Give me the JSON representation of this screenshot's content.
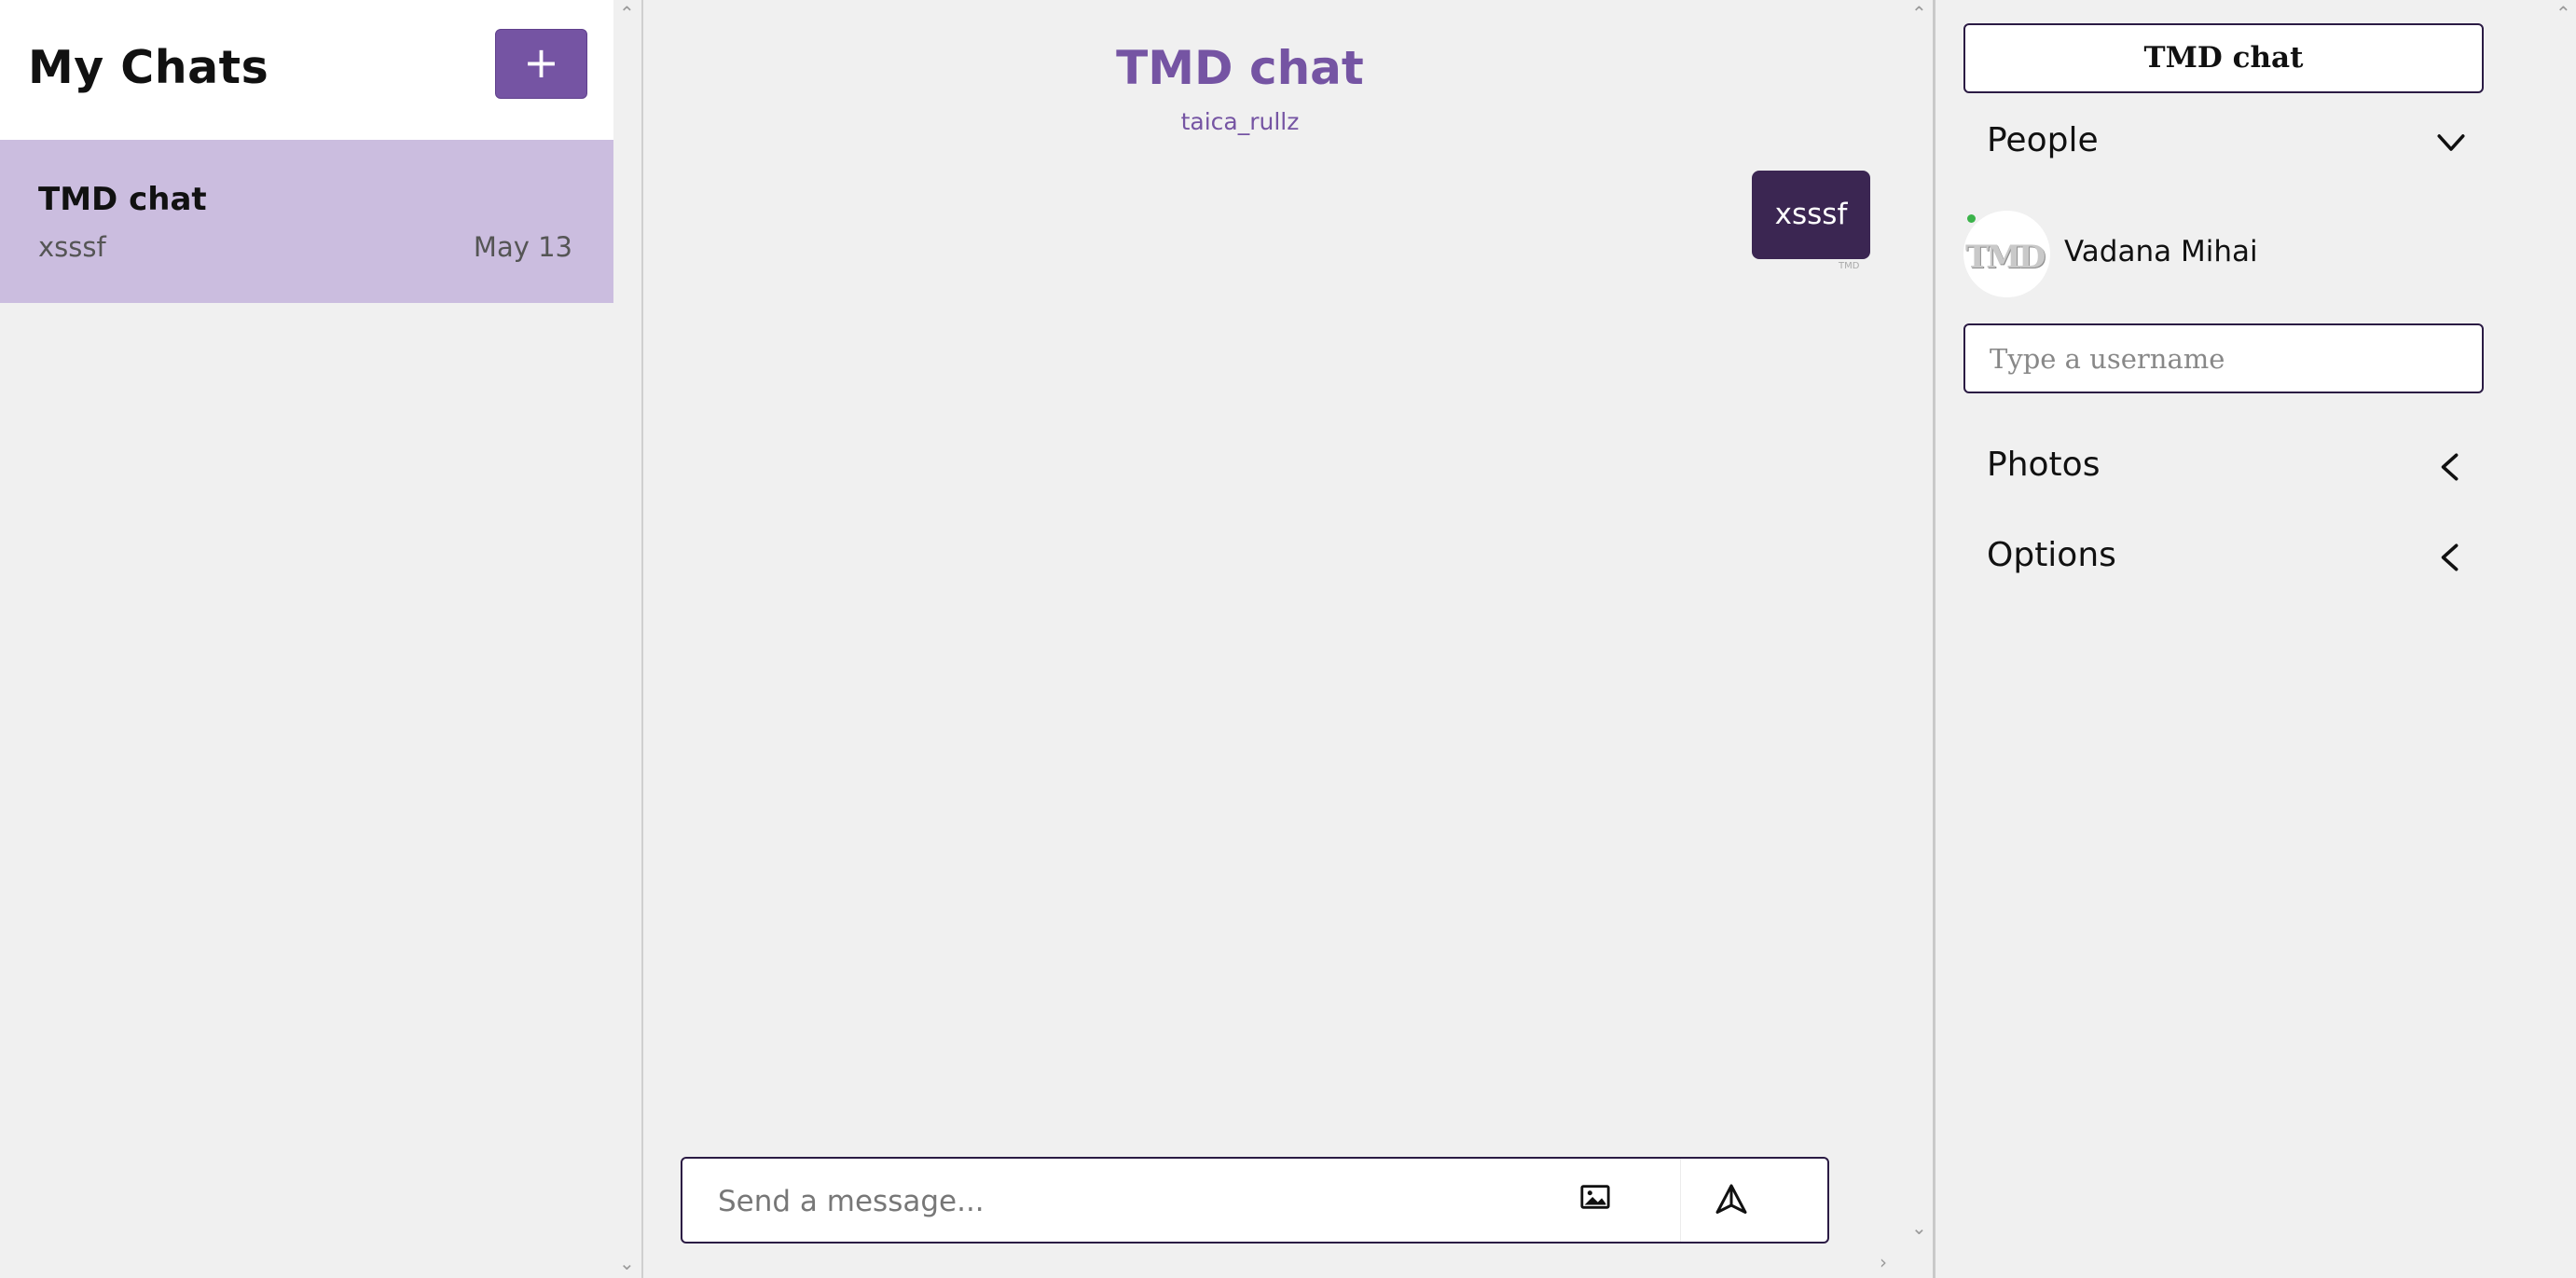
{
  "sidebar": {
    "title": "My Chats",
    "new_chat_label": "+",
    "chats": [
      {
        "title": "TMD chat",
        "last_message": "xsssf",
        "date": "May 13"
      }
    ]
  },
  "chat": {
    "title": "TMD chat",
    "subtitle": "taica_rullz",
    "messages": [
      {
        "text": "xsssf",
        "meta": "TMD"
      }
    ],
    "composer": {
      "placeholder": "Send a message...",
      "image_icon": "image-icon",
      "send_icon": "send-icon"
    }
  },
  "details": {
    "title": "TMD chat",
    "sections": {
      "people": {
        "label": "People",
        "state": "expanded",
        "icon": "chevron-down-icon"
      },
      "photos": {
        "label": "Photos",
        "state": "collapsed",
        "icon": "chevron-left-icon"
      },
      "options": {
        "label": "Options",
        "state": "collapsed",
        "icon": "chevron-left-icon"
      }
    },
    "people": [
      {
        "name": "Vadana Mihai",
        "avatar_text": "TMD",
        "online": true
      }
    ],
    "add_user_placeholder": "Type a username"
  },
  "colors": {
    "accent": "#7554a3",
    "selected_chat_bg": "#cbbddf",
    "message_bubble": "#3b2652",
    "border": "#2b1b44",
    "online": "#3bb34a"
  }
}
